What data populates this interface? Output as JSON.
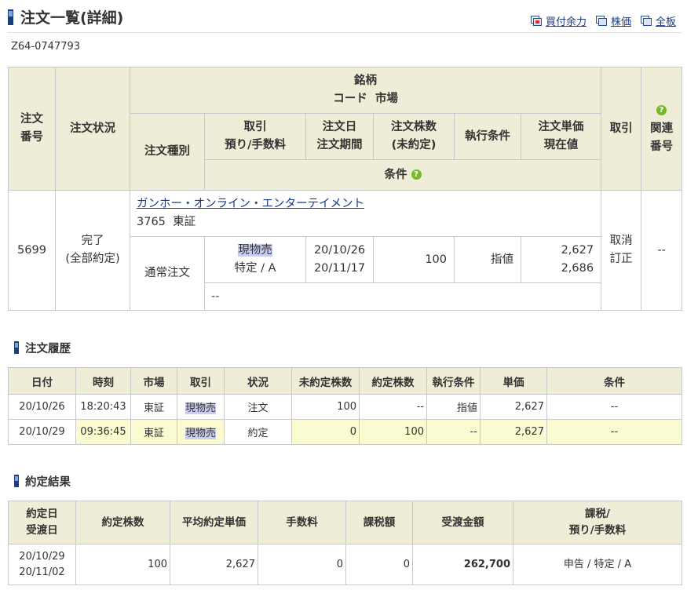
{
  "header": {
    "title": "注文一覧(詳細)",
    "links": [
      {
        "label": "買付余力",
        "icon": "buying-power-icon"
      },
      {
        "label": "株価",
        "icon": "stock-price-icon"
      },
      {
        "label": "全板",
        "icon": "full-board-icon"
      }
    ]
  },
  "account_id": "Z64-0747793",
  "detail": {
    "headers": {
      "order_no": [
        "注文",
        "番号"
      ],
      "status": "注文状況",
      "issue": "銘柄",
      "code_market": "コード  市場",
      "order_type": "注文種別",
      "trade": [
        "取引",
        "預り/手数料"
      ],
      "order_date": [
        "注文日",
        "注文期間"
      ],
      "qty": [
        "注文株数",
        "(未約定)"
      ],
      "exec": "執行条件",
      "price": [
        "注文単価",
        "現在値"
      ],
      "action": "取引",
      "related": [
        "関連",
        "番号"
      ],
      "condition": "条件",
      "help": "?"
    },
    "row": {
      "order_no": "5699",
      "status": [
        "完了",
        "(全部約定)"
      ],
      "issue_name": "ガンホー・オンライン・エンターテイメント",
      "code_market": "3765  東証",
      "order_type": "通常注文",
      "trade": "現物売",
      "account_fee": "特定 / A",
      "order_date": "20/10/26",
      "period": "20/11/17",
      "qty": "100",
      "exec": "指値",
      "price": "2,627",
      "current": "2,686",
      "actions": [
        "取消",
        "訂正"
      ],
      "related": "--",
      "condition": "--"
    }
  },
  "history": {
    "title": "注文履歴",
    "columns": [
      "日付",
      "時刻",
      "市場",
      "取引",
      "状況",
      "未約定株数",
      "約定株数",
      "執行条件",
      "単価",
      "条件"
    ],
    "rows": [
      [
        "20/10/26",
        "18:20:43",
        "東証",
        "現物売",
        "注文",
        "100",
        "--",
        "指値",
        "2,627",
        "--"
      ],
      [
        "20/10/29",
        "09:36:45",
        "東証",
        "現物売",
        "約定",
        "0",
        "100",
        "--",
        "2,627",
        "--"
      ]
    ]
  },
  "results": {
    "title": "約定結果",
    "columns": [
      [
        "約定日",
        "受渡日"
      ],
      [
        "約定株数"
      ],
      [
        "平均約定単価"
      ],
      [
        "手数料"
      ],
      [
        "課税額"
      ],
      [
        "受渡金額"
      ],
      [
        "課税/",
        "預り/手数料"
      ]
    ],
    "row": {
      "date": "20/10/29",
      "delivery": "20/11/02",
      "qty": "100",
      "avg_price": "2,627",
      "fee": "0",
      "tax": "0",
      "amount": "262,700",
      "tax_type": "申告 / 特定 / A"
    }
  },
  "colors": {
    "header_bg": "#efedd7",
    "highlight_row": "#fafbd0",
    "link": "#1a3a8a",
    "accent": "#1b3f7a"
  }
}
